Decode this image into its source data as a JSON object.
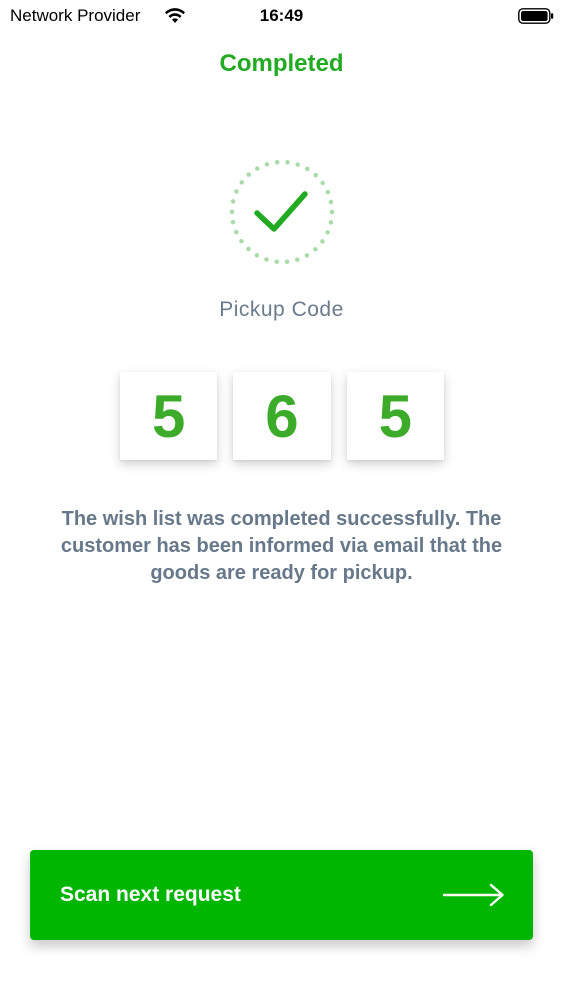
{
  "status_bar": {
    "carrier": "Network Provider",
    "time": "16:49",
    "icons": [
      "wifi-icon",
      "battery-icon"
    ]
  },
  "header": {
    "title": "Completed"
  },
  "badge": {
    "icon": "checkmark-icon",
    "color": "#22aa22"
  },
  "pickup": {
    "label": "Pickup Code",
    "digits": [
      "5",
      "6",
      "5"
    ]
  },
  "message": "The wish list was completed successfully. The customer has been informed via email that the goods are ready for pickup.",
  "cta": {
    "label": "Scan next request",
    "icon": "arrow-right-icon",
    "color": "#00b600"
  },
  "colors": {
    "accent": "#22aa22",
    "digit": "#3cab2a",
    "text_muted": "#67788a"
  }
}
